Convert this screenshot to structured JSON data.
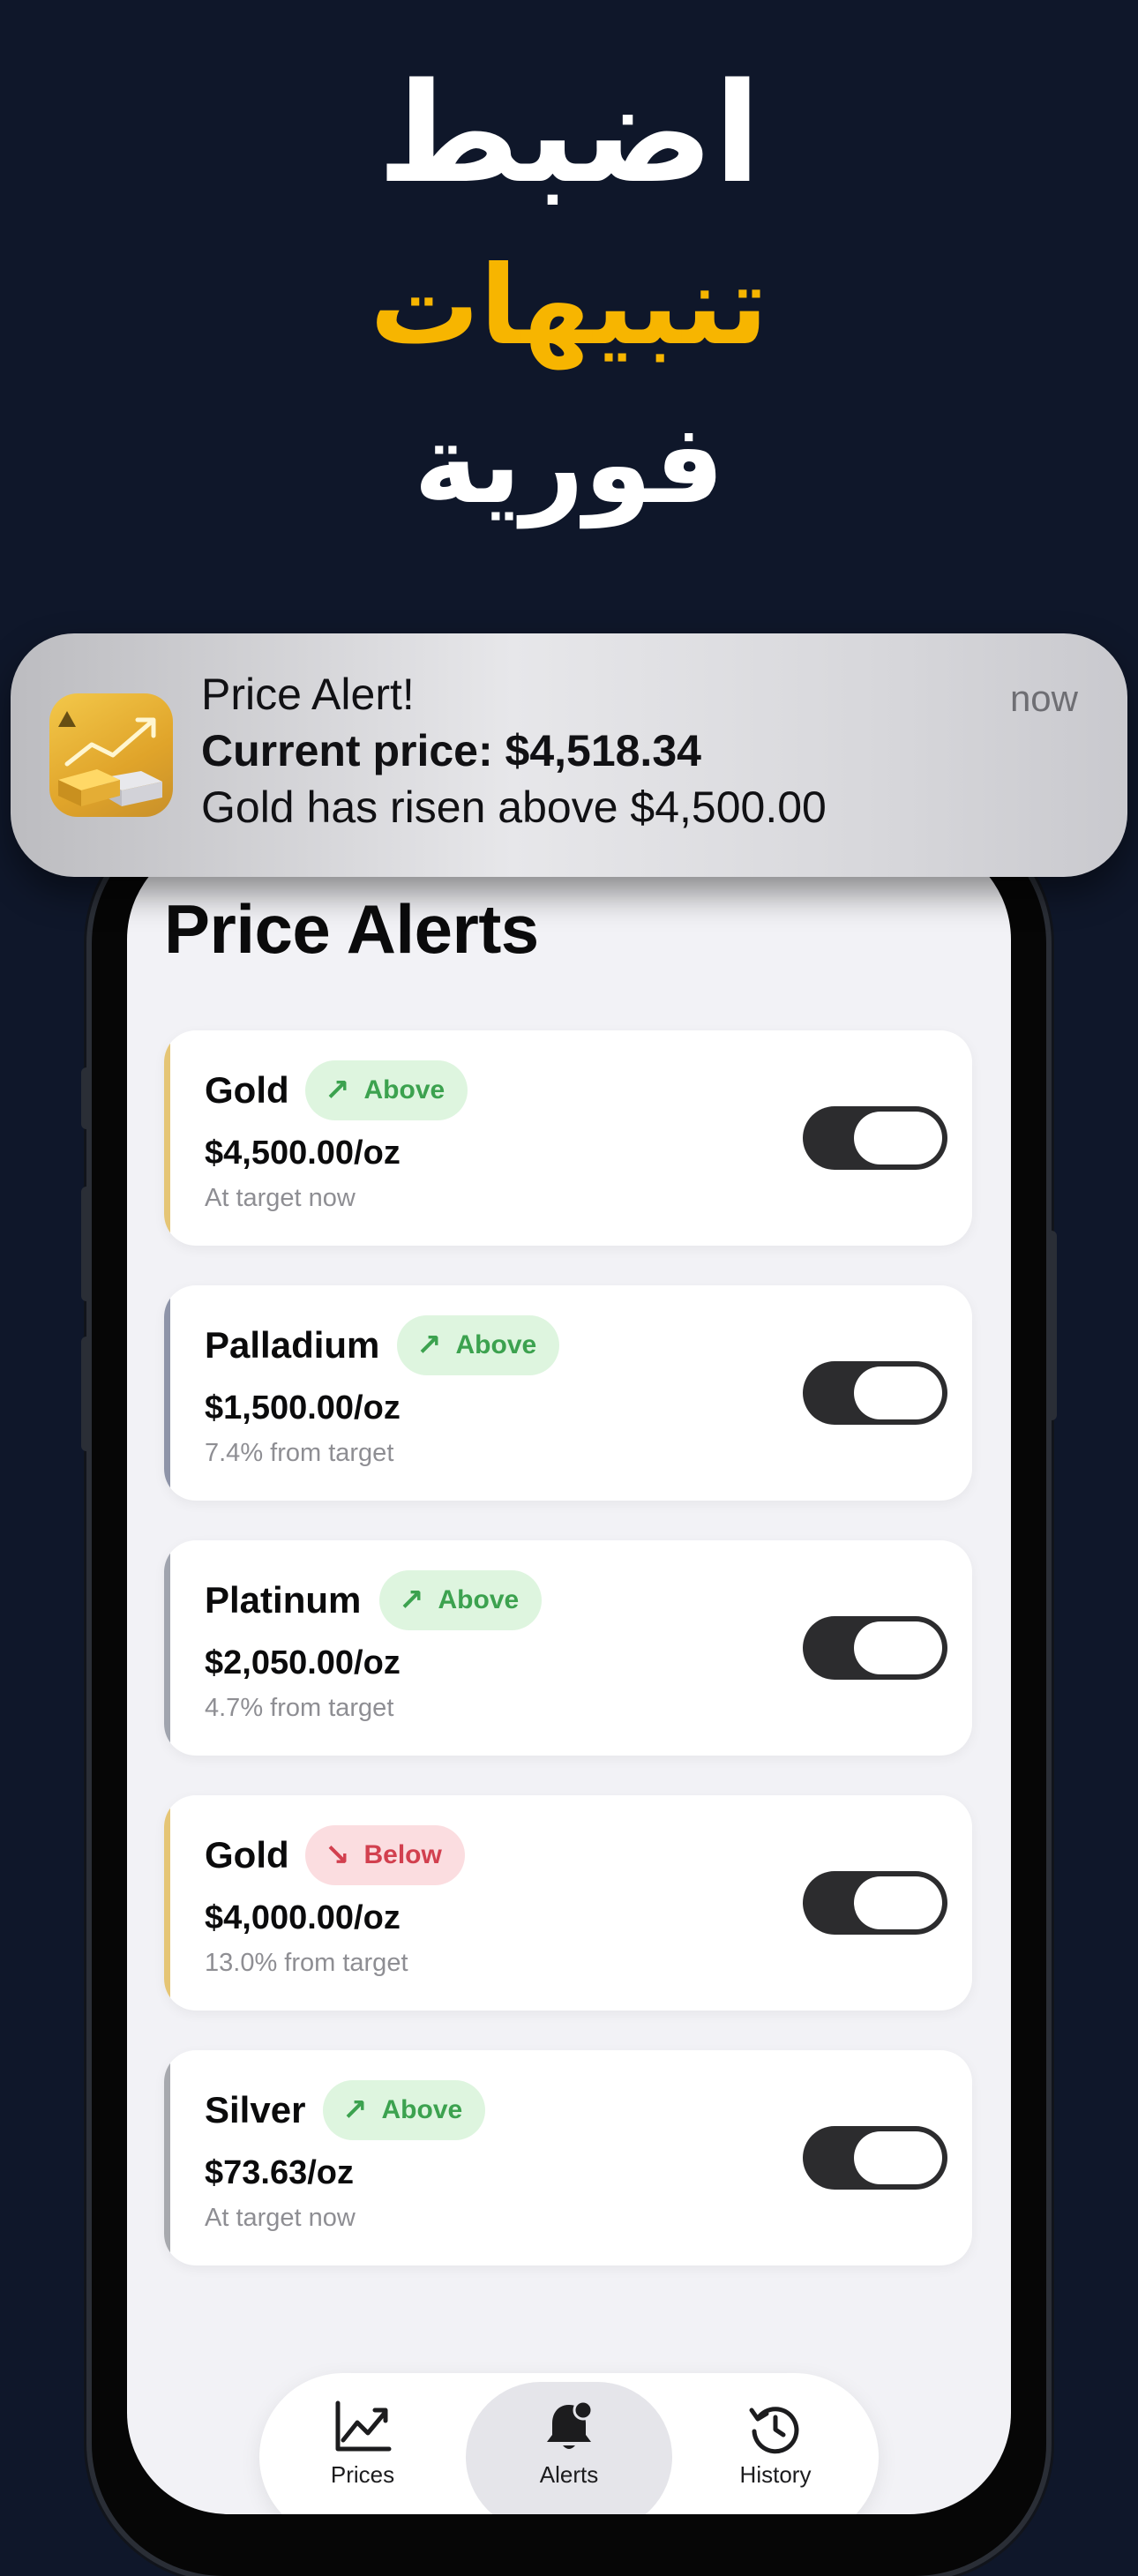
{
  "headline": {
    "line1": "اضبط",
    "line2": "تنبيهات",
    "line3": "فورية"
  },
  "colors": {
    "background": "#0f172a",
    "headline_accent": "#f7b500",
    "gold": "#e5c575",
    "palladium": "#8e94a8",
    "platinum": "#a0a4ae",
    "silver": "#a7a9ae",
    "above": "#3ca24f",
    "below": "#d2404f"
  },
  "notification": {
    "title": "Price Alert!",
    "line2": "Current price: $4,518.34",
    "line3": "Gold has risen above $4,500.00",
    "time": "now",
    "icon": "gold-bars-chart-icon"
  },
  "screen": {
    "title": "Price Alerts"
  },
  "alerts": [
    {
      "metal": "Gold",
      "direction": "Above",
      "arrow": "↗",
      "price": "$4,500.00/oz",
      "status": "At target now",
      "enabled": true
    },
    {
      "metal": "Palladium",
      "direction": "Above",
      "arrow": "↗",
      "price": "$1,500.00/oz",
      "status": "7.4% from target",
      "enabled": true
    },
    {
      "metal": "Platinum",
      "direction": "Above",
      "arrow": "↗",
      "price": "$2,050.00/oz",
      "status": "4.7% from target",
      "enabled": true
    },
    {
      "metal": "Gold",
      "direction": "Below",
      "arrow": "↘",
      "price": "$4,000.00/oz",
      "status": "13.0% from target",
      "enabled": true
    },
    {
      "metal": "Silver",
      "direction": "Above",
      "arrow": "↗",
      "price": "$73.63/oz",
      "status": "At target now",
      "enabled": true
    }
  ],
  "tab_bar": {
    "tabs": [
      {
        "label": "Prices",
        "icon": "chart-line-icon"
      },
      {
        "label": "Alerts",
        "icon": "bell-icon"
      },
      {
        "label": "History",
        "icon": "history-clock-icon"
      }
    ],
    "active": "Alerts"
  }
}
